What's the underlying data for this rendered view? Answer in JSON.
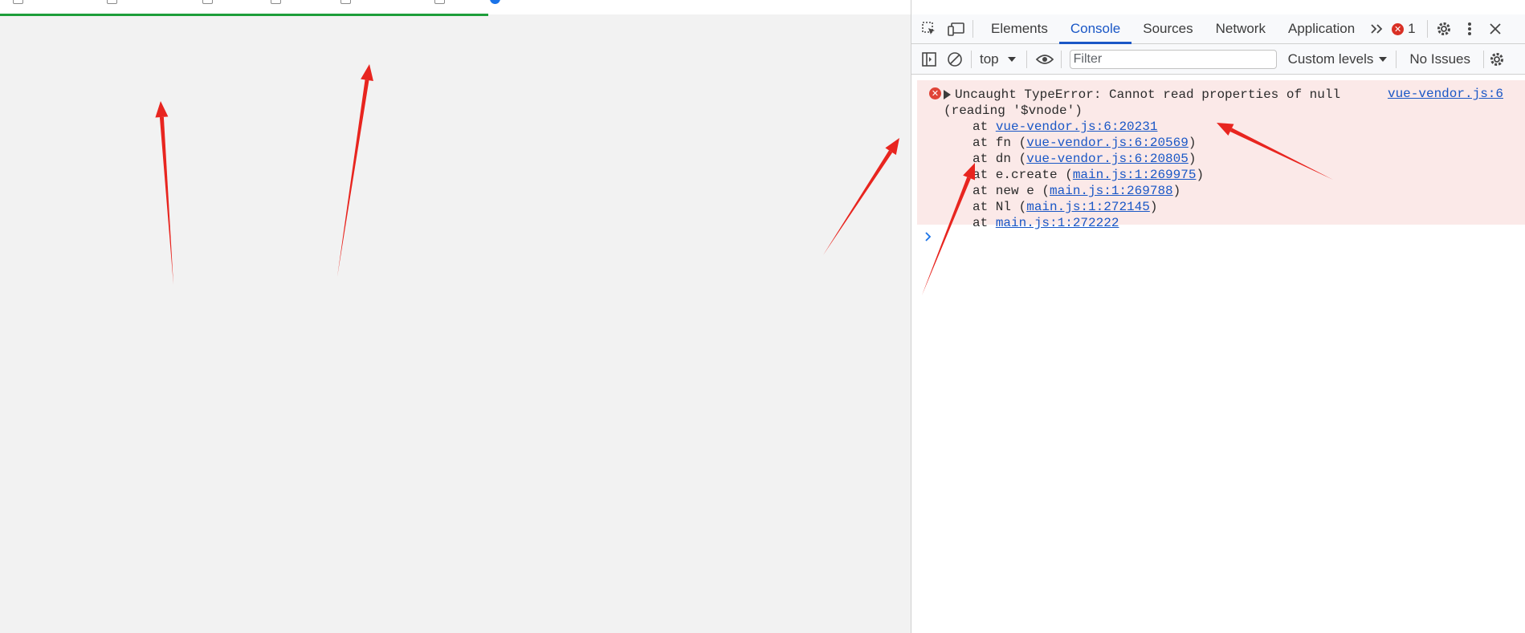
{
  "page": {
    "bookmarks": [
      "",
      "",
      "",
      "",
      "",
      "",
      ""
    ],
    "loading_progress": 0.32
  },
  "devtools": {
    "tabs": [
      {
        "label": "Elements",
        "active": false
      },
      {
        "label": "Console",
        "active": true
      },
      {
        "label": "Sources",
        "active": false
      },
      {
        "label": "Network",
        "active": false
      },
      {
        "label": "Application",
        "active": false
      }
    ],
    "more_tabs_icon": "chevron-double-right-icon",
    "error_count": "1",
    "toolbar": {
      "context": "top",
      "filter_placeholder": "Filter",
      "levels": "Custom levels",
      "issues": "No Issues"
    },
    "console": {
      "message_line1": "Uncaught TypeError: Cannot read properties of null",
      "message_line2": "(reading '$vnode')",
      "source": "vue-vendor.js:6",
      "stack": [
        {
          "prefix": "at ",
          "link": "vue-vendor.js:6:20231",
          "suffix": ""
        },
        {
          "prefix": "at fn (",
          "link": "vue-vendor.js:6:20569",
          "suffix": ")"
        },
        {
          "prefix": "at dn (",
          "link": "vue-vendor.js:6:20805",
          "suffix": ")"
        },
        {
          "prefix": "at e.create (",
          "link": "main.js:1:269975",
          "suffix": ")"
        },
        {
          "prefix": "at new e (",
          "link": "main.js:1:269788",
          "suffix": ")"
        },
        {
          "prefix": "at Nl (",
          "link": "main.js:1:272145",
          "suffix": ")"
        },
        {
          "prefix": "at ",
          "link": "main.js:1:272222",
          "suffix": ""
        }
      ],
      "prompt": ">"
    }
  },
  "colors": {
    "accent": "#1a57c6",
    "error_bg": "#fbe9e8",
    "error_icon": "#e04336",
    "annotation_arrow": "#e8251f",
    "loading_bar": "#1e9e3a"
  }
}
